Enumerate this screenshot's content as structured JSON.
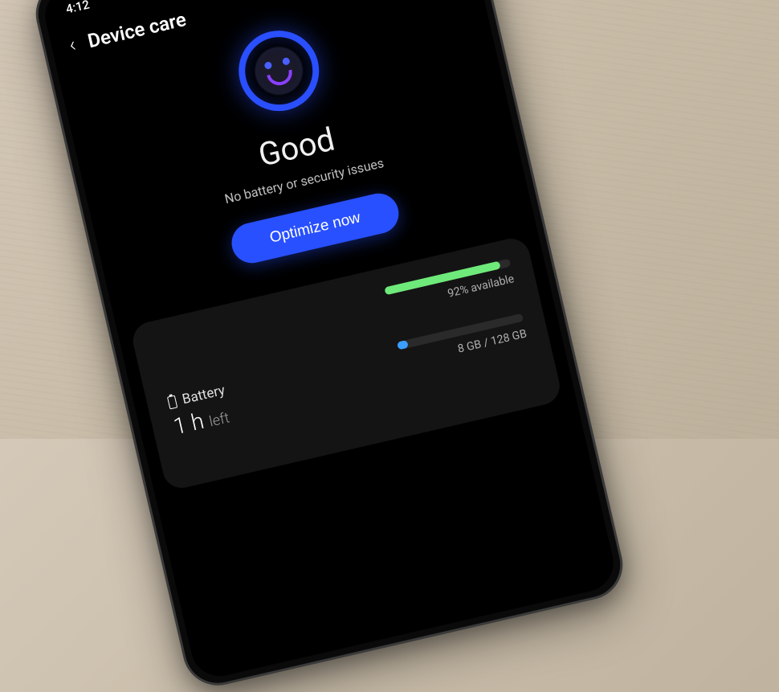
{
  "status_bar": {
    "time": "4:12"
  },
  "header": {
    "title": "Device care"
  },
  "main": {
    "status_title": "Good",
    "status_subtitle": "No battery or security issues",
    "optimize_label": "Optimize now"
  },
  "cards": {
    "memory": {
      "available_label": "92% available",
      "percent": 92
    },
    "battery": {
      "title": "Battery",
      "time_value": "1 h",
      "time_suffix": "left"
    },
    "storage": {
      "used": "8 GB",
      "total": "128 GB"
    }
  }
}
